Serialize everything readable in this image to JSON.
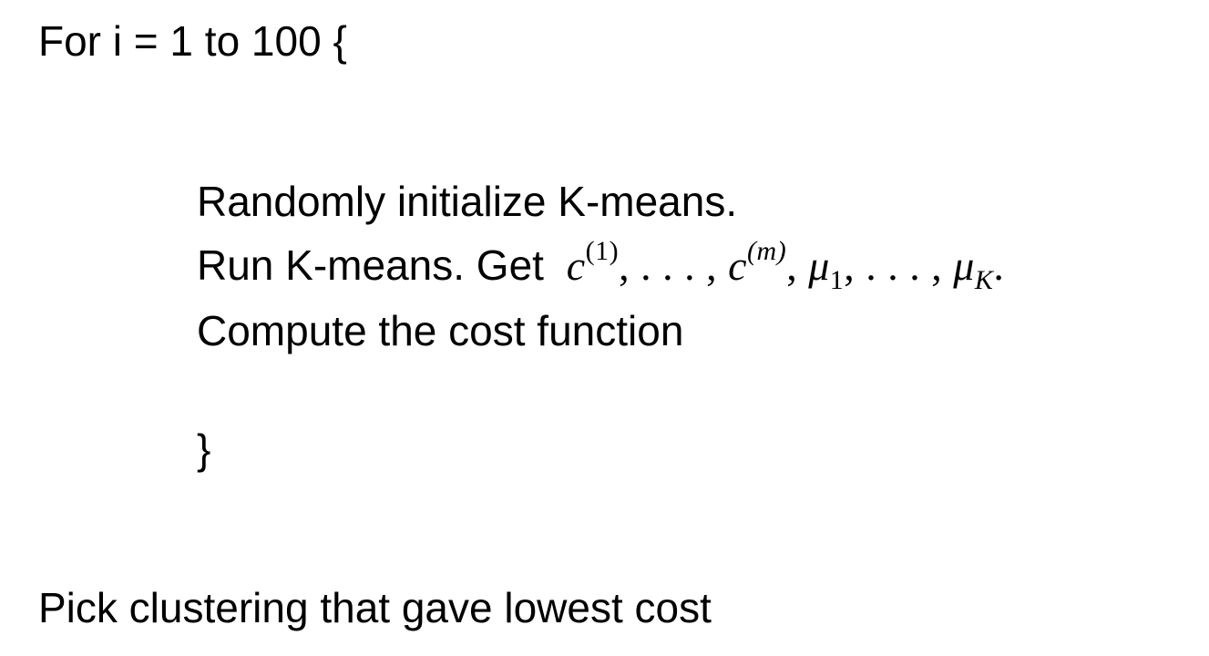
{
  "document": {
    "loop_header": "For i = 1 to 100 {",
    "steps": [
      "Randomly initialize K-means.",
      "Run K-means. Get",
      "Compute the cost function"
    ],
    "step2_math": {
      "c": "c",
      "c_sup_first": "(1)",
      "sep1": ", . . . , ",
      "c_sup_last": "(m)",
      "sep2": ", ",
      "mu": "μ",
      "mu_sub_first": "1",
      "sep3": ", . . . , ",
      "mu_sub_last": "K",
      "end": "."
    },
    "close_brace": "}",
    "final_step": "Pick clustering that gave lowest cost"
  }
}
